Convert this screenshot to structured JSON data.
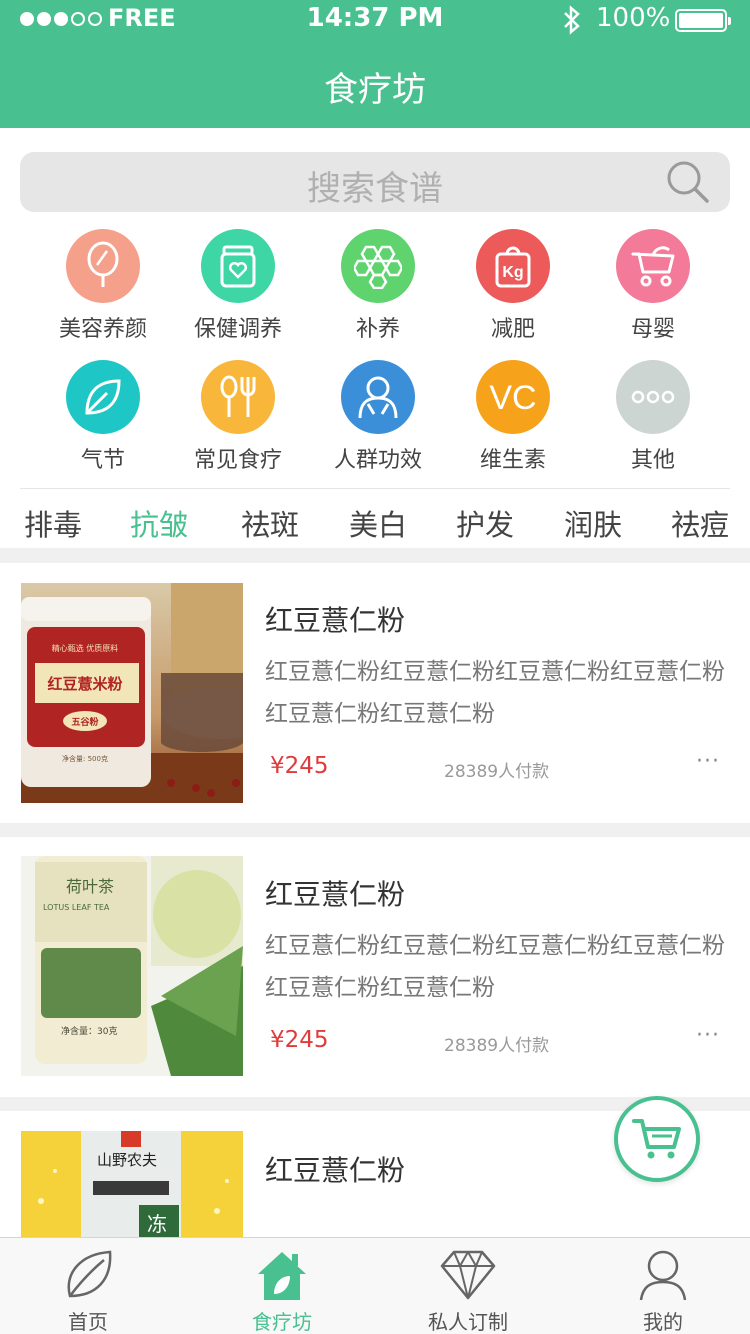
{
  "status_bar": {
    "carrier": "FREE",
    "time": "14:37 PM",
    "battery": "100%"
  },
  "header": {
    "title": "食疗坊"
  },
  "search": {
    "placeholder": "搜索食谱"
  },
  "categories": [
    {
      "label": "美容养颜",
      "icon": "mirror-icon",
      "color": "#f5a08a"
    },
    {
      "label": "保健调养",
      "icon": "jar-heart-icon",
      "color": "#3fd6a6"
    },
    {
      "label": "补养",
      "icon": "honeycomb-icon",
      "color": "#5fd36e"
    },
    {
      "label": "减肥",
      "icon": "kg-weight-icon",
      "color": "#ec5a5a"
    },
    {
      "label": "母婴",
      "icon": "stroller-icon",
      "color": "#f47a9a"
    },
    {
      "label": "气节",
      "icon": "leaf-icon",
      "color": "#1ec7c5"
    },
    {
      "label": "常见食疗",
      "icon": "spoon-fork-icon",
      "color": "#f8b73a"
    },
    {
      "label": "人群功效",
      "icon": "people-icon",
      "color": "#3a8fd8"
    },
    {
      "label": "维生素",
      "icon": "vc-icon",
      "color": "#f7a21b"
    },
    {
      "label": "其他",
      "icon": "more-dots-icon",
      "color": "#cdd5d2"
    }
  ],
  "tabs": [
    {
      "label": "排毒",
      "active": false
    },
    {
      "label": "抗皱",
      "active": true
    },
    {
      "label": "祛斑",
      "active": false
    },
    {
      "label": "美白",
      "active": false
    },
    {
      "label": "护发",
      "active": false
    },
    {
      "label": "润肤",
      "active": false
    },
    {
      "label": "祛痘",
      "active": false
    }
  ],
  "products": [
    {
      "name": "红豆薏仁粉",
      "description": "红豆薏仁粉红豆薏仁粉红豆薏仁粉红豆薏仁粉红豆薏仁粉红豆薏仁粉",
      "price": "¥245",
      "sold": "28389人付款",
      "more": "···",
      "image_text": {
        "label": "红豆薏米粉",
        "top": "精心甄选 优质原料",
        "badge": "五谷粉",
        "net": "净含量: 500克"
      }
    },
    {
      "name": "红豆薏仁粉",
      "description": "红豆薏仁粉红豆薏仁粉红豆薏仁粉红豆薏仁粉红豆薏仁粉红豆薏仁粉",
      "price": "¥245",
      "sold": "28389人付款",
      "more": "···",
      "image_text": {
        "label": "荷叶茶",
        "sub": "LOTUS LEAF TEA",
        "net": "净含量：30克"
      }
    },
    {
      "name": "红豆薏仁粉",
      "image_text": {
        "brand": "山野农夫",
        "tag": "冻"
      }
    }
  ],
  "cart": {
    "icon": "cart-icon"
  },
  "bottom_nav": [
    {
      "label": "首页",
      "icon": "leaf-outline-icon",
      "active": false
    },
    {
      "label": "食疗坊",
      "icon": "home-leaf-icon",
      "active": true
    },
    {
      "label": "私人订制",
      "icon": "diamond-icon",
      "active": false
    },
    {
      "label": "我的",
      "icon": "user-icon",
      "active": false
    }
  ],
  "colors": {
    "brand": "#48c08f",
    "price": "#e03b3b",
    "background": "#f0f0f0"
  }
}
